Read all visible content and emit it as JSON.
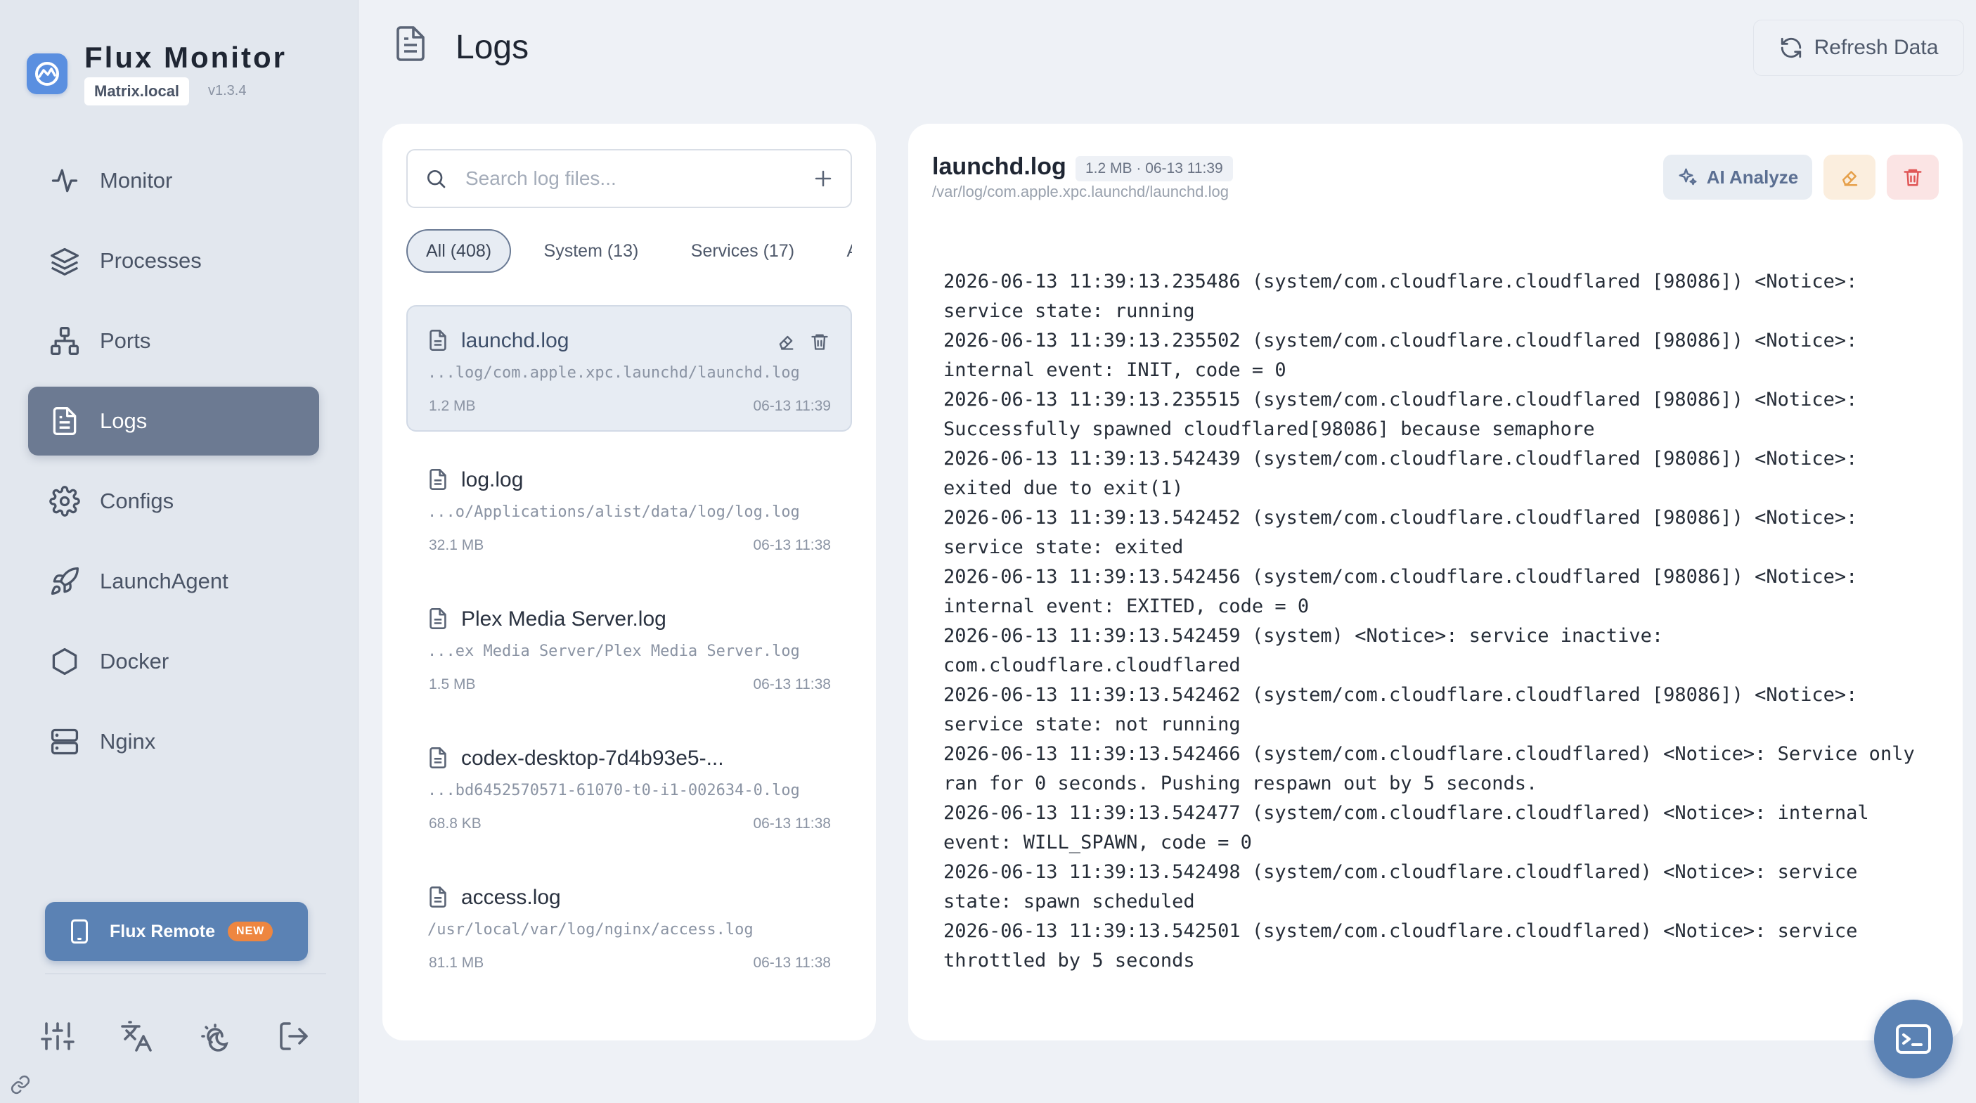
{
  "app": {
    "name": "Flux Monitor",
    "host": "Matrix.local",
    "version": "v1.3.4"
  },
  "sidebar": {
    "items": [
      {
        "label": "Monitor",
        "icon": "activity-icon",
        "active": false
      },
      {
        "label": "Processes",
        "icon": "layers-icon",
        "active": false
      },
      {
        "label": "Ports",
        "icon": "network-icon",
        "active": false
      },
      {
        "label": "Logs",
        "icon": "file-text-icon",
        "active": true
      },
      {
        "label": "Configs",
        "icon": "gear-icon",
        "active": false
      },
      {
        "label": "LaunchAgent",
        "icon": "rocket-icon",
        "active": false
      },
      {
        "label": "Docker",
        "icon": "hexagon-icon",
        "active": false
      },
      {
        "label": "Nginx",
        "icon": "server-icon",
        "active": false
      }
    ],
    "remote": {
      "label": "Flux Remote",
      "badge": "NEW"
    },
    "tools": [
      "sliders-icon",
      "translate-icon",
      "theme-icon",
      "logout-icon"
    ]
  },
  "header": {
    "title": "Logs",
    "refresh_label": "Refresh Data"
  },
  "list": {
    "search_placeholder": "Search log files...",
    "filters": [
      {
        "label": "All (408)",
        "active": true
      },
      {
        "label": "System (13)",
        "active": false
      },
      {
        "label": "Services (17)",
        "active": false
      },
      {
        "label": "Ap",
        "active": false
      }
    ],
    "files": [
      {
        "name": "launchd.log",
        "path": "...log/com.apple.xpc.launchd/launchd.log",
        "size": "1.2 MB",
        "date": "06-13 11:39",
        "active": true
      },
      {
        "name": "log.log",
        "path": "...o/Applications/alist/data/log/log.log",
        "size": "32.1 MB",
        "date": "06-13 11:38",
        "active": false
      },
      {
        "name": "Plex Media Server.log",
        "path": "...ex Media Server/Plex Media Server.log",
        "size": "1.5 MB",
        "date": "06-13 11:38",
        "active": false
      },
      {
        "name": "codex-desktop-7d4b93e5-...",
        "path": "...bd6452570571-61070-t0-i1-002634-0.log",
        "size": "68.8 KB",
        "date": "06-13 11:38",
        "active": false
      },
      {
        "name": "access.log",
        "path": "/usr/local/var/log/nginx/access.log",
        "size": "81.1 MB",
        "date": "06-13 11:38",
        "active": false
      }
    ]
  },
  "viewer": {
    "filename": "launchd.log",
    "meta": "1.2 MB · 06-13 11:39",
    "path": "/var/log/com.apple.xpc.launchd/launchd.log",
    "ai_label": "AI Analyze",
    "lines": [
      "2026-06-13 11:39:13.235486 (system/com.cloudflare.cloudflared [98086]) <Notice>:",
      "service state: running",
      "2026-06-13 11:39:13.235502 (system/com.cloudflare.cloudflared [98086]) <Notice>:",
      "internal event: INIT, code = 0",
      "2026-06-13 11:39:13.235515 (system/com.cloudflare.cloudflared [98086]) <Notice>:",
      "Successfully spawned cloudflared[98086] because semaphore",
      "2026-06-13 11:39:13.542439 (system/com.cloudflare.cloudflared [98086]) <Notice>:",
      "exited due to exit(1)",
      "2026-06-13 11:39:13.542452 (system/com.cloudflare.cloudflared [98086]) <Notice>:",
      "service state: exited",
      "2026-06-13 11:39:13.542456 (system/com.cloudflare.cloudflared [98086]) <Notice>:",
      "internal event: EXITED, code = 0",
      "2026-06-13 11:39:13.542459 (system) <Notice>: service inactive:",
      "com.cloudflare.cloudflared",
      "2026-06-13 11:39:13.542462 (system/com.cloudflare.cloudflared [98086]) <Notice>:",
      "service state: not running",
      "2026-06-13 11:39:13.542466 (system/com.cloudflare.cloudflared) <Notice>: Service only",
      "ran for 0 seconds. Pushing respawn out by 5 seconds.",
      "2026-06-13 11:39:13.542477 (system/com.cloudflare.cloudflared) <Notice>: internal",
      "event: WILL_SPAWN, code = 0",
      "2026-06-13 11:39:13.542498 (system/com.cloudflare.cloudflared) <Notice>: service",
      "state: spawn scheduled",
      "2026-06-13 11:39:13.542501 (system/com.cloudflare.cloudflared) <Notice>: service",
      "throttled by 5 seconds"
    ]
  },
  "colors": {
    "accent": "#5b82b4",
    "nav_active": "#6c7a92",
    "badge_new": "#ee8640",
    "danger": "#e05555",
    "warning": "#e6a04a"
  }
}
